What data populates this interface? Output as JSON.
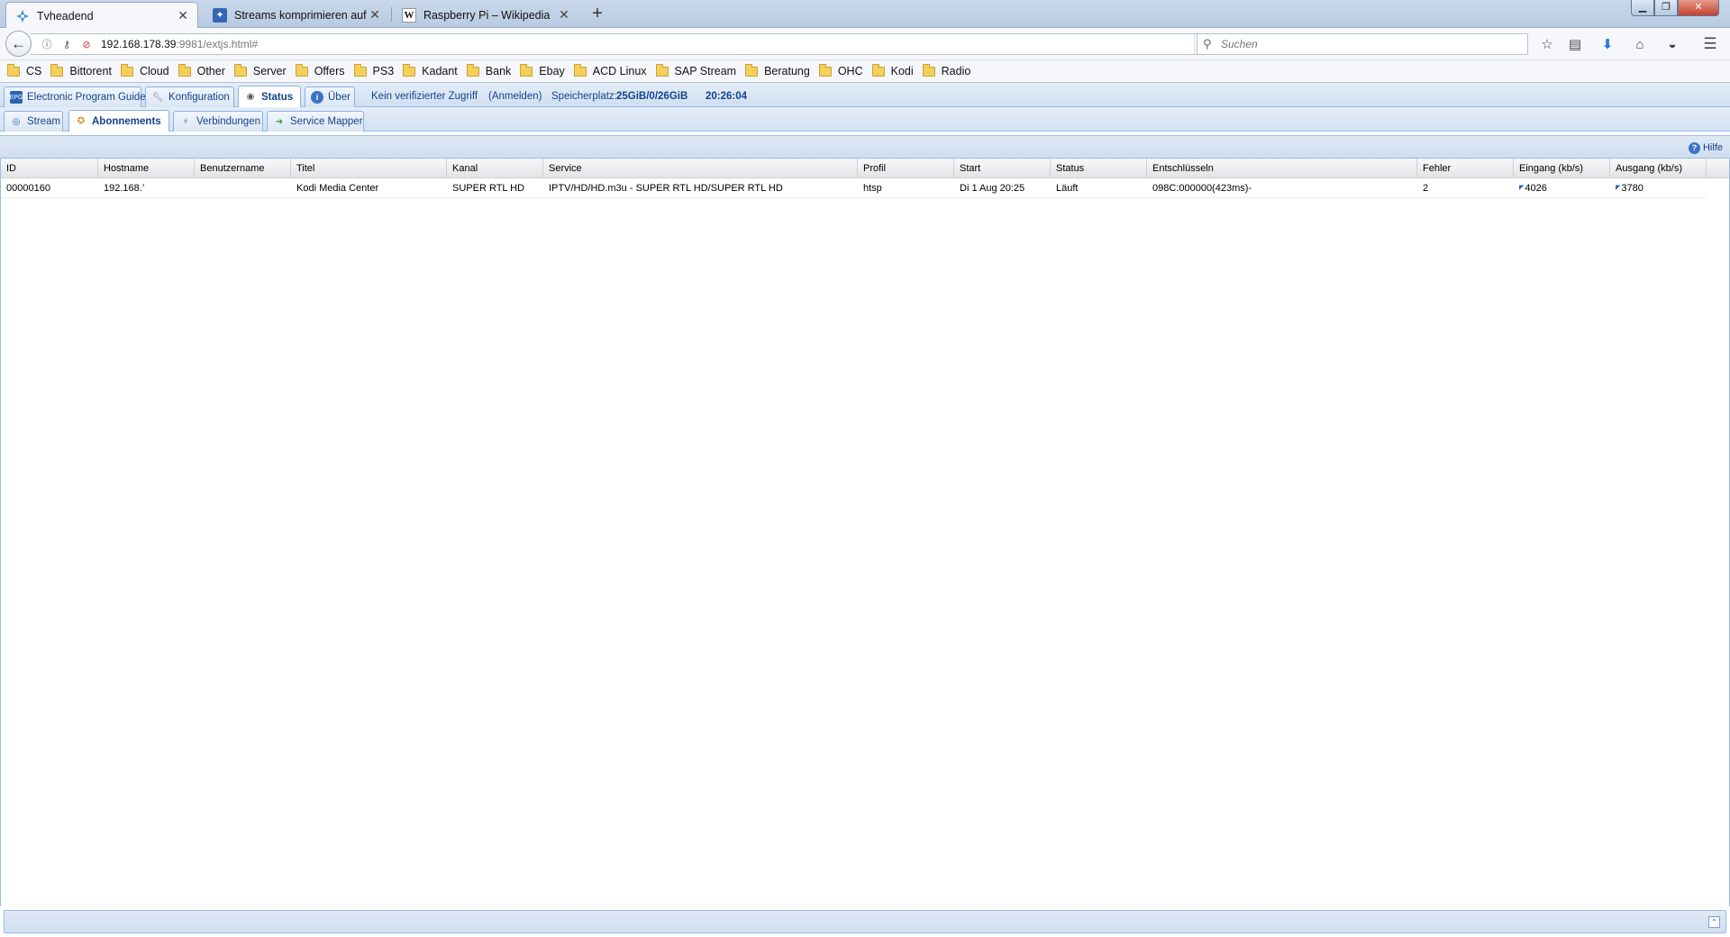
{
  "browser": {
    "tabs": [
      {
        "label": "Tvheadend",
        "favicon": "tvheadend-icon",
        "active": true
      },
      {
        "label": "Streams komprimieren auf T’",
        "favicon": "forum-icon",
        "active": false
      },
      {
        "label": "Raspberry Pi – Wikipedia",
        "favicon": "wikipedia-icon",
        "favicon_text": "W",
        "active": false
      }
    ],
    "new_tab_symbol": "+",
    "url": "192.168.178.39",
    "url_rest": ":9981/extjs.html#",
    "search_placeholder": "Suchen",
    "bookmarks": [
      "CS",
      "Bittorent",
      "Cloud",
      "Other",
      "Server",
      "Offers",
      "PS3",
      "Kadant",
      "Bank",
      "Ebay",
      "ACD Linux",
      "SAP Stream",
      "Beratung",
      "OHC",
      "Kodi",
      "Radio"
    ],
    "folder_color": "#f4cf5c"
  },
  "app": {
    "main_tabs": [
      {
        "label": "Electronic Program Guide",
        "icon": "epg-icon"
      },
      {
        "label": "Konfiguration",
        "icon": "wrench-icon"
      },
      {
        "label": "Status",
        "icon": "eye-icon"
      },
      {
        "label": "Über",
        "icon": "info-icon"
      }
    ],
    "access_text": "Kein verifizierter Zugriff",
    "login_text": "(Anmelden)",
    "storage_label": "Speicherplatz:",
    "storage_value": "25GiB/0/26GiB",
    "clock": "20:26:04",
    "sub_tabs": [
      {
        "label": "Stream",
        "icon": "antenna-icon"
      },
      {
        "label": "Abonnements",
        "icon": "subscription-icon"
      },
      {
        "label": "Verbindungen",
        "icon": "connection-icon"
      },
      {
        "label": "Service Mapper",
        "icon": "arrow-right-icon"
      }
    ],
    "help_label": "Hilfe",
    "accent_color": "#15428b",
    "grid": {
      "columns": [
        "ID",
        "Hostname",
        "Benutzername",
        "Titel",
        "Kanal",
        "Service",
        "Profil",
        "Start",
        "Status",
        "Entschlüsseln",
        "Fehler",
        "Eingang (kb/s)",
        "Ausgang (kb/s)"
      ],
      "rows": [
        [
          "00000160",
          "192.168.’",
          "",
          "Kodi Media Center",
          "SUPER RTL HD",
          "IPTV/HD/HD.m3u - SUPER RTL HD/SUPER RTL HD",
          "htsp",
          "Di 1 Aug 20:25",
          "Läuft",
          "098C:000000(423ms)-",
          "2",
          "4026",
          "3780"
        ]
      ]
    }
  }
}
